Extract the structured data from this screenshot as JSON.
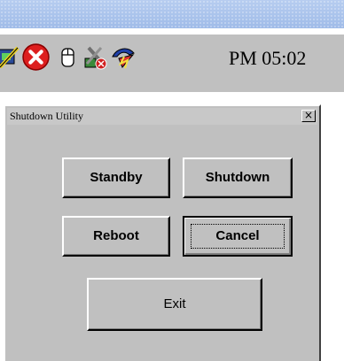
{
  "taskbar": {
    "clock": "PM 05:02",
    "tray_icons": [
      "network-icon",
      "error-icon",
      "mouse-icon",
      "tools-icon",
      "power-icon"
    ]
  },
  "dialog": {
    "title": "Shutdown Utility",
    "close_label": "×",
    "buttons": {
      "standby": "Standby",
      "shutdown": "Shutdown",
      "reboot": "Reboot",
      "cancel": "Cancel",
      "exit": "Exit"
    }
  },
  "colors": {
    "face": "#c0c0c0",
    "error_red": "#dd1e1e",
    "desktop_blue": "#a8c2ec"
  }
}
